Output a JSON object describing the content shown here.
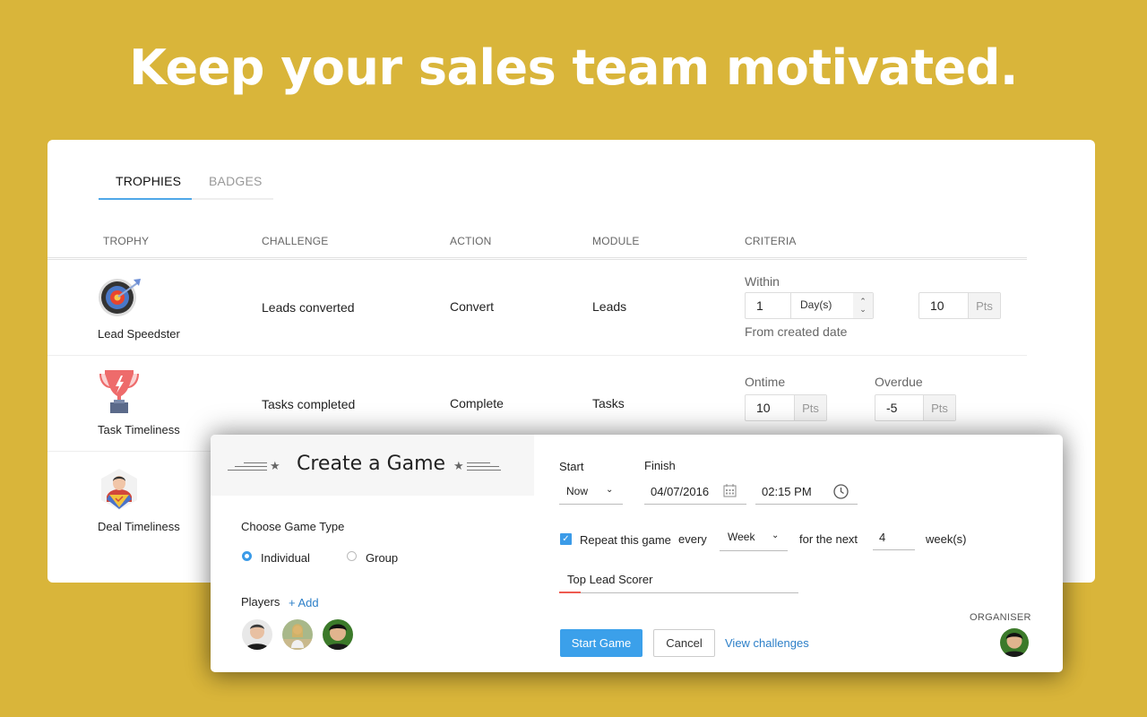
{
  "hero": {
    "headline": "Keep your sales team motivated."
  },
  "tabs": [
    {
      "label": "TROPHIES",
      "active": true
    },
    {
      "label": "BADGES",
      "active": false
    }
  ],
  "table": {
    "headers": [
      "TROPHY",
      "CHALLENGE",
      "ACTION",
      "MODULE",
      "CRITERIA"
    ],
    "rows": [
      {
        "trophy": "Lead Speedster",
        "icon": "target-icon",
        "challenge": "Leads converted",
        "action": "Convert",
        "module": "Leads",
        "criteria": {
          "within_label": "Within",
          "within_value": "1",
          "unit": "Day(s)",
          "points": "10",
          "points_suffix": "Pts",
          "note": "From created date"
        }
      },
      {
        "trophy": "Task Timeliness",
        "icon": "trophy-cup-icon",
        "challenge": "Tasks completed",
        "action": "Complete",
        "module": "Tasks",
        "criteria": {
          "ontime_label": "Ontime",
          "ontime_value": "10",
          "overdue_label": "Overdue",
          "overdue_value": "-5",
          "points_suffix": "Pts"
        }
      },
      {
        "trophy": "Deal Timeliness",
        "icon": "superhero-icon"
      }
    ]
  },
  "dialog": {
    "title": "Create a Game",
    "game_type_label": "Choose Game Type",
    "game_types": [
      {
        "label": "Individual",
        "selected": true
      },
      {
        "label": "Group",
        "selected": false
      }
    ],
    "players_label": "Players",
    "add_label": "+ Add",
    "players": [
      "player-1",
      "player-2",
      "player-3"
    ],
    "start_label": "Start",
    "start_value": "Now",
    "finish_label": "Finish",
    "finish_date": "04/07/2016",
    "finish_time": "02:15 PM",
    "repeat_checked": true,
    "repeat_label": "Repeat this game",
    "every_label": "every",
    "interval_value": "Week",
    "for_next_label": "for the next",
    "count_value": "4",
    "count_unit": "week(s)",
    "game_name": "Top Lead Scorer",
    "organiser_label": "ORGANISER",
    "start_button": "Start Game",
    "cancel_button": "Cancel",
    "view_challenges": "View challenges"
  },
  "colors": {
    "background": "#D9B53A",
    "accent": "#3BA0EA",
    "link": "#2C7FC8"
  }
}
